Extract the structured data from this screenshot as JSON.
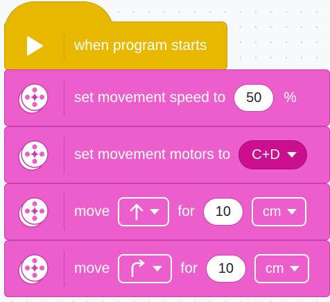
{
  "blocks": {
    "start": {
      "label": "when program starts"
    },
    "speed": {
      "label": "set movement speed to",
      "value": "50",
      "unit": "%"
    },
    "motors": {
      "label": "set movement motors to",
      "selection": "C+D"
    },
    "move_forward": {
      "verb": "move",
      "direction_icon": "arrow-up-icon",
      "for_label": "for",
      "amount": "10",
      "unit": "cm"
    },
    "move_turn": {
      "verb": "move",
      "direction_icon": "turn-right-icon",
      "for_label": "for",
      "amount": "10",
      "unit": "cm"
    }
  },
  "colors": {
    "events": "#e8b800",
    "movement": "#ec5ecb",
    "movement_dark": "#cc0f8f"
  }
}
